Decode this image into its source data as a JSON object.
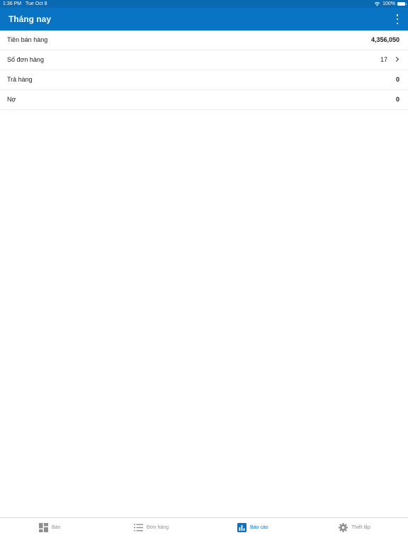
{
  "status_bar": {
    "time": "1:36 PM",
    "date": "Tue Oct 8",
    "battery": "100%",
    "wifi_icon": "wifi-icon",
    "battery_icon": "battery-icon"
  },
  "header": {
    "title": "Tháng nay",
    "menu_icon": "more-vertical-icon"
  },
  "rows": [
    {
      "label": "Tiền bán hàng",
      "value": "4,356,050"
    },
    {
      "label": "Số đơn hàng",
      "value": "17",
      "icon": "chevron-right-icon"
    },
    {
      "label": "Trả hàng",
      "value": "0"
    },
    {
      "label": "Nợ",
      "value": "0"
    }
  ],
  "tabs": [
    {
      "label": "Bán",
      "icon": "grid-icon",
      "active": false
    },
    {
      "label": "Đơn hàng",
      "icon": "list-icon",
      "active": false
    },
    {
      "label": "Báo cáo",
      "icon": "bar-chart-icon",
      "active": true
    },
    {
      "label": "Thiết lập",
      "icon": "gear-icon",
      "active": false
    }
  ],
  "colors": {
    "primary": "#0a74c4",
    "inactive_tab": "#8e8e93"
  }
}
